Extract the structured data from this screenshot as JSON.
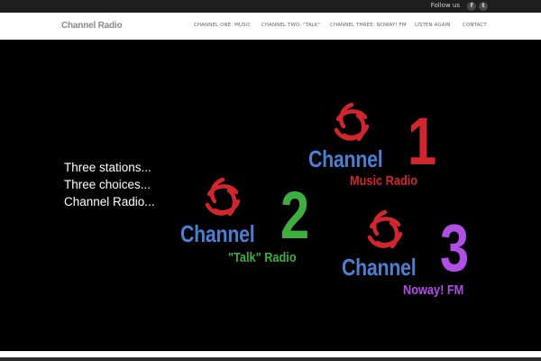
{
  "topbar": {
    "follow_label": "Follow us",
    "social": [
      {
        "name": "facebook-icon",
        "glyph": "f"
      },
      {
        "name": "twitter-icon",
        "glyph": "t"
      }
    ]
  },
  "header": {
    "brand": "Channel Radio",
    "nav": [
      {
        "label": "CHANNEL ONE: MUSIC"
      },
      {
        "label": "CHANNEL TWO: \"TALK\""
      },
      {
        "label": "CHANNEL THREE: NOWAY! FM"
      },
      {
        "label": "LISTEN AGAIN"
      },
      {
        "label": "CONTACT"
      }
    ]
  },
  "hero": {
    "tagline": [
      "Three stations...",
      "Three choices...",
      "Channel Radio..."
    ],
    "channels": [
      {
        "word": "Channel",
        "number": "1",
        "subtitle": "Music Radio",
        "number_color": "#d2262f",
        "subtitle_color": "#d2262f"
      },
      {
        "word": "Channel",
        "number": "2",
        "subtitle": "\"Talk\" Radio",
        "number_color": "#3fae3f",
        "subtitle_color": "#3fae3f"
      },
      {
        "word": "Channel",
        "number": "3",
        "subtitle": "Noway! FM",
        "number_color": "#b14ee6",
        "subtitle_color": "#b14ee6"
      }
    ],
    "word_color": "#4a7fd1",
    "logo_color": "#d2262f"
  }
}
